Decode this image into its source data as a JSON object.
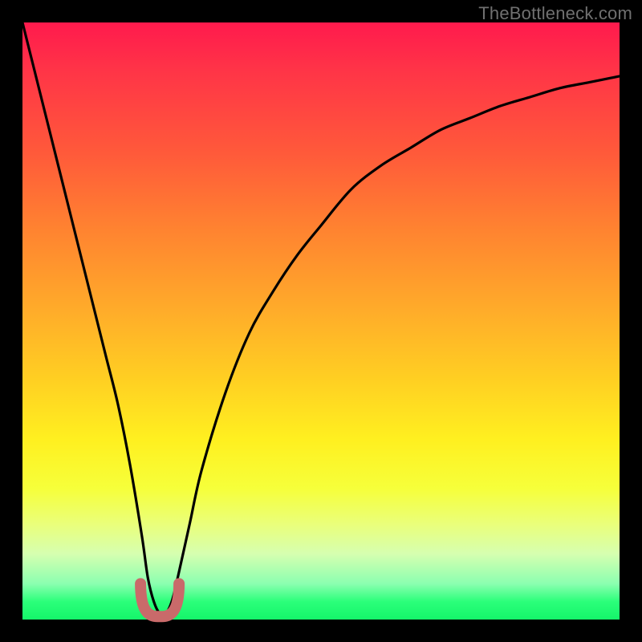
{
  "watermark": "TheBottleneck.com",
  "colors": {
    "frame": "#000000",
    "curve": "#000000",
    "nub": "#c96a6a",
    "watermark": "#707070"
  },
  "chart_data": {
    "type": "line",
    "title": "",
    "xlabel": "",
    "ylabel": "",
    "xlim": [
      0,
      100
    ],
    "ylim": [
      0,
      100
    ],
    "series": [
      {
        "name": "bottleneck-curve",
        "x": [
          0,
          2,
          4,
          6,
          8,
          10,
          12,
          14,
          16,
          18,
          20,
          21,
          22,
          23,
          24,
          25,
          26,
          28,
          30,
          34,
          38,
          42,
          46,
          50,
          55,
          60,
          65,
          70,
          75,
          80,
          85,
          90,
          95,
          100
        ],
        "values": [
          100,
          92,
          84,
          76,
          68,
          60,
          52,
          44,
          36,
          26,
          14,
          7,
          3,
          1,
          1,
          3,
          7,
          16,
          25,
          38,
          48,
          55,
          61,
          66,
          72,
          76,
          79,
          82,
          84,
          86,
          87.5,
          89,
          90,
          91
        ]
      }
    ],
    "annotations": [
      {
        "name": "minimum-nub",
        "x": 23,
        "y": 1
      }
    ]
  }
}
